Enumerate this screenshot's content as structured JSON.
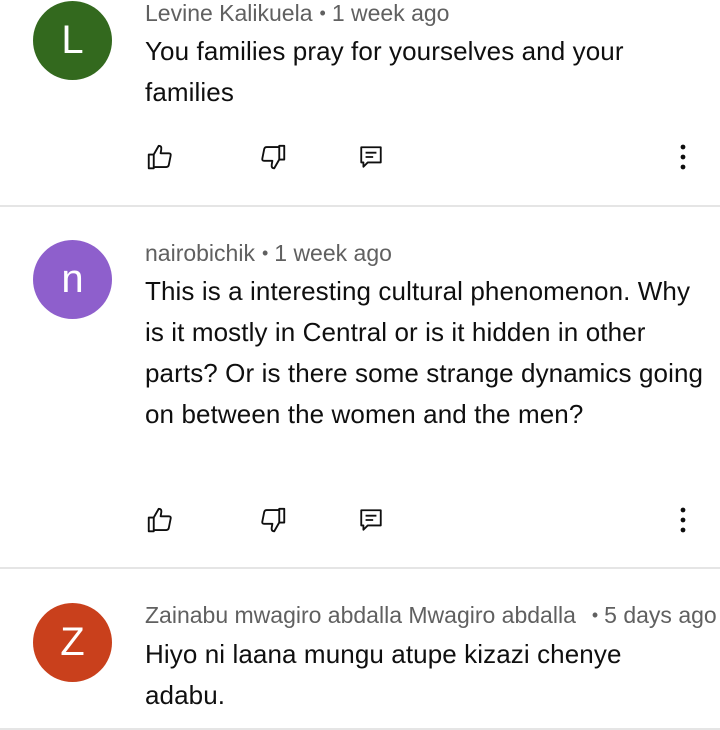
{
  "comments": [
    {
      "initial": "L",
      "avatar_color": "#33691e",
      "author": "Levine Kalikuela",
      "separator": "•",
      "time": "1 week ago",
      "text": "You families pray for yourselves and your families"
    },
    {
      "initial": "n",
      "avatar_color": "#8e5fcc",
      "author": "nairobichik",
      "separator": "•",
      "time": "1 week ago",
      "text": "This is a interesting cultural phenomenon. Why is it mostly in Central or is it hidden in other parts? Or is there some strange dynamics going on between the women and the men?"
    },
    {
      "initial": "Z",
      "avatar_color": "#c9401c",
      "author": "Zainabu mwagiro abdalla Mwagiro abdalla",
      "separator": "•",
      "time": "5 days ago",
      "text": "Hiyo ni laana mungu atupe kizazi chenye adabu."
    }
  ],
  "icons": {
    "like": "thumbs-up-icon",
    "dislike": "thumbs-down-icon",
    "reply": "reply-comment-icon",
    "more": "more-vert-icon"
  }
}
